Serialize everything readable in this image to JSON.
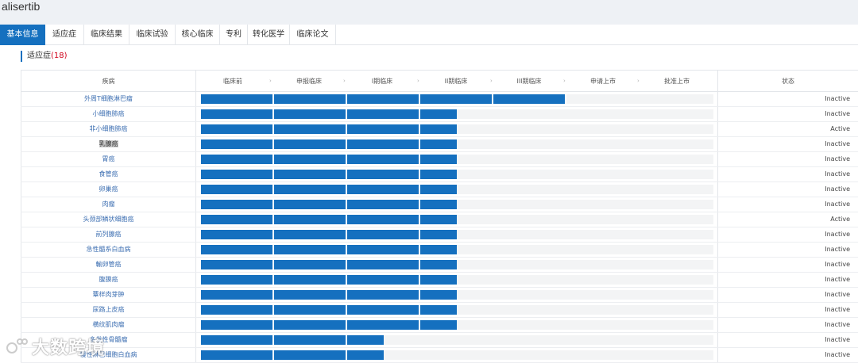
{
  "header": {
    "drug_name": "alisertib"
  },
  "tabs": [
    {
      "label": "基本信息",
      "active": true
    },
    {
      "label": "适应症",
      "active": false
    },
    {
      "label": "临床结果",
      "active": false
    },
    {
      "label": "临床试验",
      "active": false
    },
    {
      "label": "核心临床",
      "active": false
    },
    {
      "label": "专利",
      "active": false
    },
    {
      "label": "转化医学",
      "active": false
    },
    {
      "label": "临床论文",
      "active": false
    }
  ],
  "section": {
    "title": "适应症",
    "count": "(18)"
  },
  "table": {
    "col_disease": "疾病",
    "col_status": "状态",
    "phases": [
      "临床前",
      "申报临床",
      "I期临床",
      "II期临床",
      "III期临床",
      "申请上市",
      "批准上市"
    ],
    "rows": [
      {
        "name": "外周T细胞淋巴瘤",
        "completed_phases": 5,
        "partial": 0,
        "status": "Inactive"
      },
      {
        "name": "小细胞肺癌",
        "completed_phases": 3,
        "partial": 0.5,
        "status": "Inactive"
      },
      {
        "name": "非小细胞肺癌",
        "completed_phases": 3,
        "partial": 0.5,
        "status": "Active"
      },
      {
        "name": "乳腺癌",
        "completed_phases": 3,
        "partial": 0.5,
        "status": "Inactive",
        "highlight": true
      },
      {
        "name": "胃癌",
        "completed_phases": 3,
        "partial": 0.5,
        "status": "Inactive"
      },
      {
        "name": "食管癌",
        "completed_phases": 3,
        "partial": 0.5,
        "status": "Inactive"
      },
      {
        "name": "卵巢癌",
        "completed_phases": 3,
        "partial": 0.5,
        "status": "Inactive"
      },
      {
        "name": "肉瘤",
        "completed_phases": 3,
        "partial": 0.5,
        "status": "Inactive"
      },
      {
        "name": "头颈部鳞状细胞癌",
        "completed_phases": 3,
        "partial": 0.5,
        "status": "Active"
      },
      {
        "name": "前列腺癌",
        "completed_phases": 3,
        "partial": 0.5,
        "status": "Inactive"
      },
      {
        "name": "急性髓系白血病",
        "completed_phases": 3,
        "partial": 0.5,
        "status": "Inactive"
      },
      {
        "name": "輸卵管癌",
        "completed_phases": 3,
        "partial": 0.5,
        "status": "Inactive"
      },
      {
        "name": "腹膜癌",
        "completed_phases": 3,
        "partial": 0.5,
        "status": "Inactive"
      },
      {
        "name": "蕈样肉芽肿",
        "completed_phases": 3,
        "partial": 0.5,
        "status": "Inactive"
      },
      {
        "name": "尿路上皮癌",
        "completed_phases": 3,
        "partial": 0.5,
        "status": "Inactive"
      },
      {
        "name": "横纹肌肉瘤",
        "completed_phases": 3,
        "partial": 0.5,
        "status": "Inactive"
      },
      {
        "name": "多发性骨髓瘤",
        "completed_phases": 2,
        "partial": 0.5,
        "status": "Inactive"
      },
      {
        "name": "慢性淋巴细胞白血病",
        "completed_phases": 2,
        "partial": 0.5,
        "status": "Inactive"
      }
    ]
  },
  "watermark": {
    "text": "大数跨境"
  },
  "colors": {
    "accent": "#1570bf",
    "track": "#f3f4f5",
    "link": "#3d6fb2",
    "count": "#d0021b"
  }
}
